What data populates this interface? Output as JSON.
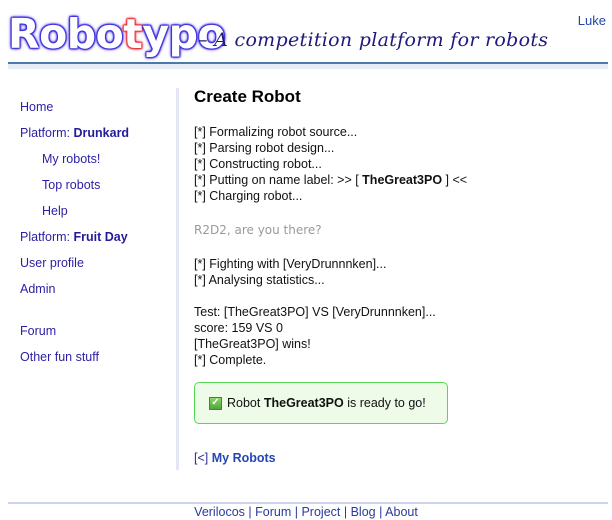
{
  "header": {
    "logo_prefix": "Robo",
    "logo_t": "t",
    "logo_suffix": "ypo",
    "tagline": "– A competition platform for robots",
    "user": "Luke"
  },
  "sidebar": {
    "items": [
      {
        "label": "Home"
      },
      {
        "prefix": "Platform: ",
        "bold": "Drunkard"
      },
      {
        "label": "My robots!"
      },
      {
        "label": "Top robots"
      },
      {
        "label": "Help"
      },
      {
        "prefix": "Platform: ",
        "bold": "Fruit Day"
      },
      {
        "label": "User profile"
      },
      {
        "label": "Admin"
      },
      {
        "label": "Forum"
      },
      {
        "label": "Other fun stuff"
      }
    ]
  },
  "main": {
    "title": "Create Robot",
    "log1": [
      "[*] Formalizing robot source...",
      "[*] Parsing robot design...",
      "[*] Constructing robot..."
    ],
    "label_line": {
      "prefix": "[*] Putting on name label: >> [ ",
      "name": "TheGreat3PO",
      "suffix": " ] <<"
    },
    "log1b": "[*] Charging robot...",
    "r2d2": "R2D2, are you there?",
    "log2": [
      "[*] Fighting with [VeryDrunnnken]...",
      "[*] Analysing statistics..."
    ],
    "log3": [
      "Test: [TheGreat3PO] VS [VeryDrunnnken]...",
      "score: 159 VS 0",
      "[TheGreat3PO] wins!",
      "[*] Complete."
    ],
    "success": {
      "icon": "check-icon",
      "prefix": "Robot ",
      "name": "TheGreat3PO",
      "suffix": " is ready to go!"
    },
    "back_link": {
      "arrow": "[<]",
      "label": "My Robots"
    }
  },
  "footer": {
    "links": [
      "Verilocos",
      "Forum",
      "Project",
      "Blog",
      "About"
    ],
    "separator": "|"
  },
  "colors": {
    "link": "#2a1fa3",
    "header_line": "#4a7aa8",
    "success_border": "#55d855",
    "success_bg": "#edfbe8"
  }
}
